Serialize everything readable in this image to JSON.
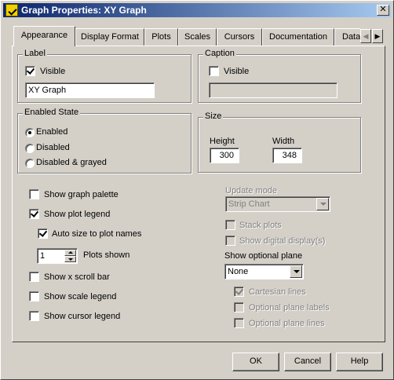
{
  "window": {
    "title": "Graph Properties: XY Graph",
    "icon": "labview-icon",
    "close_glyph": "✕"
  },
  "tabs": [
    {
      "label": "Appearance",
      "active": true
    },
    {
      "label": "Display Format"
    },
    {
      "label": "Plots"
    },
    {
      "label": "Scales"
    },
    {
      "label": "Cursors"
    },
    {
      "label": "Documentation"
    },
    {
      "label": "Data"
    }
  ],
  "tab_scroll": {
    "left": "◀",
    "right": "▶"
  },
  "label_group": {
    "title": "Label",
    "visible_label": "Visible",
    "visible_checked": true,
    "text": "XY Graph"
  },
  "caption_group": {
    "title": "Caption",
    "visible_label": "Visible",
    "visible_checked": false,
    "text": ""
  },
  "enabled_state": {
    "title": "Enabled State",
    "options": [
      "Enabled",
      "Disabled",
      "Disabled & grayed"
    ],
    "selected": "Enabled"
  },
  "size_group": {
    "title": "Size",
    "height_label": "Height",
    "height": "300",
    "width_label": "Width",
    "width": "348"
  },
  "left_options": {
    "show_graph_palette": {
      "label": "Show graph palette",
      "checked": false
    },
    "show_plot_legend": {
      "label": "Show plot legend",
      "checked": true
    },
    "auto_size": {
      "label": "Auto size to plot names",
      "checked": true
    },
    "plots_shown_value": "1",
    "plots_shown_label": "Plots shown",
    "show_x_scroll_bar": {
      "label": "Show x scroll bar",
      "checked": false
    },
    "show_scale_legend": {
      "label": "Show scale legend",
      "checked": false
    },
    "show_cursor_legend": {
      "label": "Show cursor legend",
      "checked": false
    }
  },
  "right_options": {
    "update_mode_label": "Update mode",
    "update_mode_value": "Strip Chart",
    "stack_plots": {
      "label": "Stack plots",
      "checked": false,
      "disabled": true
    },
    "show_digital_displays": {
      "label": "Show digital display(s)",
      "checked": false,
      "disabled": true
    },
    "show_optional_plane_label": "Show optional plane",
    "optional_plane_value": "None",
    "cartesian_lines": {
      "label": "Cartesian lines",
      "checked": true,
      "disabled": true
    },
    "optional_plane_labels": {
      "label": "Optional plane labels",
      "checked": false,
      "disabled": true
    },
    "optional_plane_lines": {
      "label": "Optional plane lines",
      "checked": false,
      "disabled": true
    }
  },
  "buttons": {
    "ok": "OK",
    "cancel": "Cancel",
    "help": "Help"
  }
}
